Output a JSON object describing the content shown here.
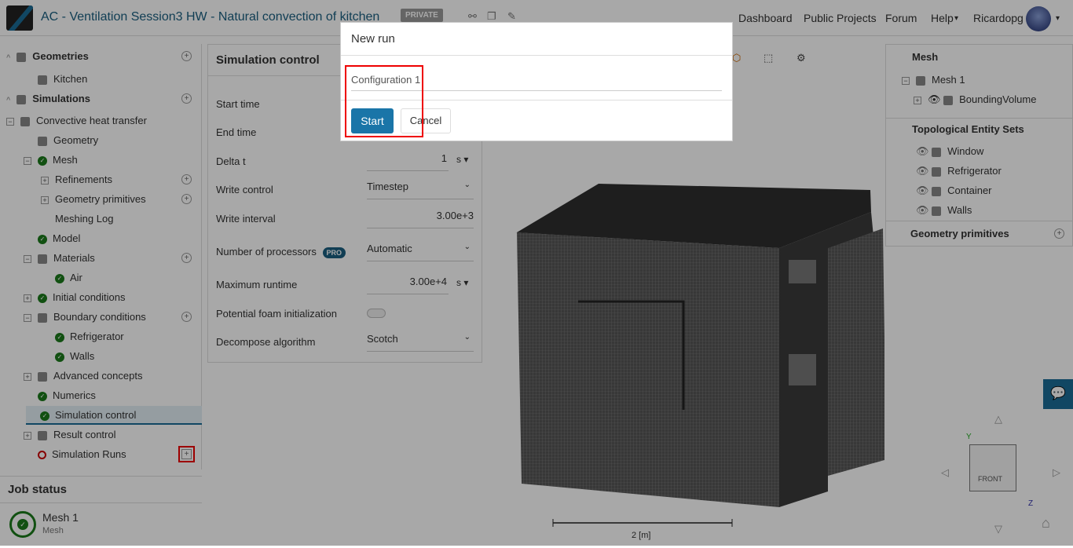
{
  "header": {
    "title": "AC - Ventilation Session3 HW - Natural convection of kitchen",
    "privacy_badge": "PRIVATE",
    "nav": [
      "Dashboard",
      "Public Projects",
      "Forum",
      "Help"
    ],
    "user": "Ricardopg"
  },
  "tree": [
    {
      "label": "Geometries",
      "section": true,
      "plus": true,
      "indent": 0
    },
    {
      "label": "Kitchen",
      "indent": 1
    },
    {
      "label": "Simulations",
      "section": true,
      "plus": true,
      "indent": 0
    },
    {
      "label": "Convective heat transfer",
      "exp": "-",
      "indent": 0
    },
    {
      "label": "Geometry",
      "indent": 1
    },
    {
      "label": "Mesh",
      "exp": "-",
      "indent": 1,
      "check": true
    },
    {
      "label": "Refinements",
      "exp": "+",
      "indent": 2,
      "plus": true
    },
    {
      "label": "Geometry primitives",
      "exp": "+",
      "indent": 2,
      "plus": true
    },
    {
      "label": "Meshing Log",
      "indent": 2
    },
    {
      "label": "Model",
      "indent": 1,
      "check": true
    },
    {
      "label": "Materials",
      "exp": "-",
      "indent": 1,
      "plus": true
    },
    {
      "label": "Air",
      "indent": 2,
      "check": true
    },
    {
      "label": "Initial conditions",
      "exp": "+",
      "indent": 1,
      "check": true
    },
    {
      "label": "Boundary conditions",
      "exp": "-",
      "indent": 1,
      "plus": true
    },
    {
      "label": "Refrigerator",
      "indent": 2,
      "check": true
    },
    {
      "label": "Walls",
      "indent": 2,
      "check": true
    },
    {
      "label": "Advanced concepts",
      "exp": "+",
      "indent": 1
    },
    {
      "label": "Numerics",
      "indent": 1,
      "check": true
    },
    {
      "label": "Simulation control",
      "indent": 1,
      "check": true,
      "selected": true
    },
    {
      "label": "Result control",
      "exp": "+",
      "indent": 1
    },
    {
      "label": "Simulation Runs",
      "indent": 1,
      "error": true,
      "plus": true,
      "highlight": true
    }
  ],
  "job_status": {
    "title": "Job status",
    "job_name": "Mesh 1",
    "job_type": "Mesh"
  },
  "sim_control": {
    "title": "Simulation control",
    "fields": [
      {
        "label": "Start time",
        "value": ""
      },
      {
        "label": "End time",
        "value": ""
      },
      {
        "label": "Delta t",
        "value": "1",
        "unit": "s"
      },
      {
        "label": "Write control",
        "value": "Timestep",
        "dropdown": true
      },
      {
        "label": "Write interval",
        "value": "3.00e+3"
      },
      {
        "label": "Number of processors",
        "value": "Automatic",
        "dropdown": true,
        "badge": "PRO"
      },
      {
        "label": "Maximum runtime",
        "value": "3.00e+4",
        "unit": "s"
      },
      {
        "label": "Potential foam initialization",
        "toggle": false
      },
      {
        "label": "Decompose algorithm",
        "value": "Scotch",
        "dropdown": true
      }
    ]
  },
  "right_panel": {
    "mesh_title": "Mesh",
    "mesh_item": "Mesh 1",
    "mesh_child": "BoundingVolume",
    "tes_title": "Topological Entity Sets",
    "tes_items": [
      "Window",
      "Refrigerator",
      "Container",
      "Walls"
    ],
    "geo_prim_title": "Geometry primitives"
  },
  "viewer": {
    "scale_label": "2 [m]",
    "cube_label": "FRONT",
    "axes": [
      "Y",
      "Z"
    ]
  },
  "modal": {
    "title": "New run",
    "name_value": "Configuration 1",
    "start_label": "Start",
    "cancel_label": "Cancel"
  },
  "colors": {
    "accent": "#1a6d96",
    "success": "#1b7a1b",
    "highlight": "#e00000"
  }
}
